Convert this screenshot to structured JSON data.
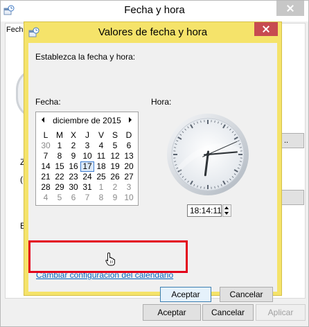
{
  "background_window": {
    "title": "Fecha y hora",
    "tab_label": "Fech",
    "peek_button_text": "..",
    "peek_letters": [
      "Z",
      "(U",
      "E"
    ],
    "footer_buttons": {
      "accept": "Aceptar",
      "cancel": "Cancelar",
      "apply": "Aplicar"
    }
  },
  "dialog": {
    "title": "Valores de fecha y hora",
    "instruction": "Establezca la fecha y hora:",
    "date_label": "Fecha:",
    "time_label": "Hora:",
    "calendar": {
      "month_label": "diciembre de 2015",
      "weekday_headers": [
        "L",
        "M",
        "X",
        "J",
        "V",
        "S",
        "D"
      ],
      "weeks": [
        [
          {
            "d": "30",
            "o": true
          },
          {
            "d": "1"
          },
          {
            "d": "2"
          },
          {
            "d": "3"
          },
          {
            "d": "4"
          },
          {
            "d": "5"
          },
          {
            "d": "6"
          }
        ],
        [
          {
            "d": "7"
          },
          {
            "d": "8"
          },
          {
            "d": "9"
          },
          {
            "d": "10"
          },
          {
            "d": "11"
          },
          {
            "d": "12"
          },
          {
            "d": "13"
          }
        ],
        [
          {
            "d": "14"
          },
          {
            "d": "15"
          },
          {
            "d": "16"
          },
          {
            "d": "17",
            "today": true
          },
          {
            "d": "18"
          },
          {
            "d": "19"
          },
          {
            "d": "20"
          }
        ],
        [
          {
            "d": "21"
          },
          {
            "d": "22"
          },
          {
            "d": "23"
          },
          {
            "d": "24"
          },
          {
            "d": "25"
          },
          {
            "d": "26"
          },
          {
            "d": "27"
          }
        ],
        [
          {
            "d": "28"
          },
          {
            "d": "29"
          },
          {
            "d": "30"
          },
          {
            "d": "31"
          },
          {
            "d": "1",
            "o": true
          },
          {
            "d": "2",
            "o": true
          },
          {
            "d": "3",
            "o": true
          }
        ],
        [
          {
            "d": "4",
            "o": true
          },
          {
            "d": "5",
            "o": true
          },
          {
            "d": "6",
            "o": true
          },
          {
            "d": "7",
            "o": true
          },
          {
            "d": "8",
            "o": true
          },
          {
            "d": "9",
            "o": true
          },
          {
            "d": "10",
            "o": true
          }
        ]
      ],
      "selected_day": "17"
    },
    "clock": {
      "hours": 18,
      "minutes": 14,
      "seconds": 11
    },
    "time_value": "18:14:11",
    "change_calendar_link": "Cambiar configuración del calendario",
    "accept_button": "Aceptar",
    "cancel_button": "Cancelar"
  },
  "colors": {
    "dialog_frame": "#f5e36a",
    "close_button": "#c74b50",
    "highlight": "#e3001b",
    "link": "#0563c1"
  }
}
